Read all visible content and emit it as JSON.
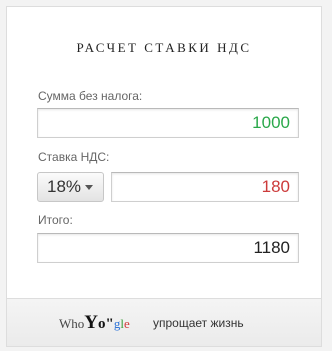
{
  "widget": {
    "title": "РАСЧЕТ СТАВКИ НДС",
    "amount_label": "Сумма без налога:",
    "amount_value": "1000",
    "rate_label": "Ставка НДС:",
    "rate_selected": "18%",
    "tax_value": "180",
    "total_label": "Итого:",
    "total_value": "1180"
  },
  "footer": {
    "brand_who": "Who",
    "brand_yo": "Y",
    "brand_o": "o",
    "brand_quote": "\"",
    "brand_g": "g",
    "brand_l": "l",
    "brand_e": "e",
    "slogan": "упрощает жизнь"
  },
  "colors": {
    "amount_text": "#2aa84a",
    "tax_text": "#cc3b3b",
    "total_text": "#222222"
  }
}
